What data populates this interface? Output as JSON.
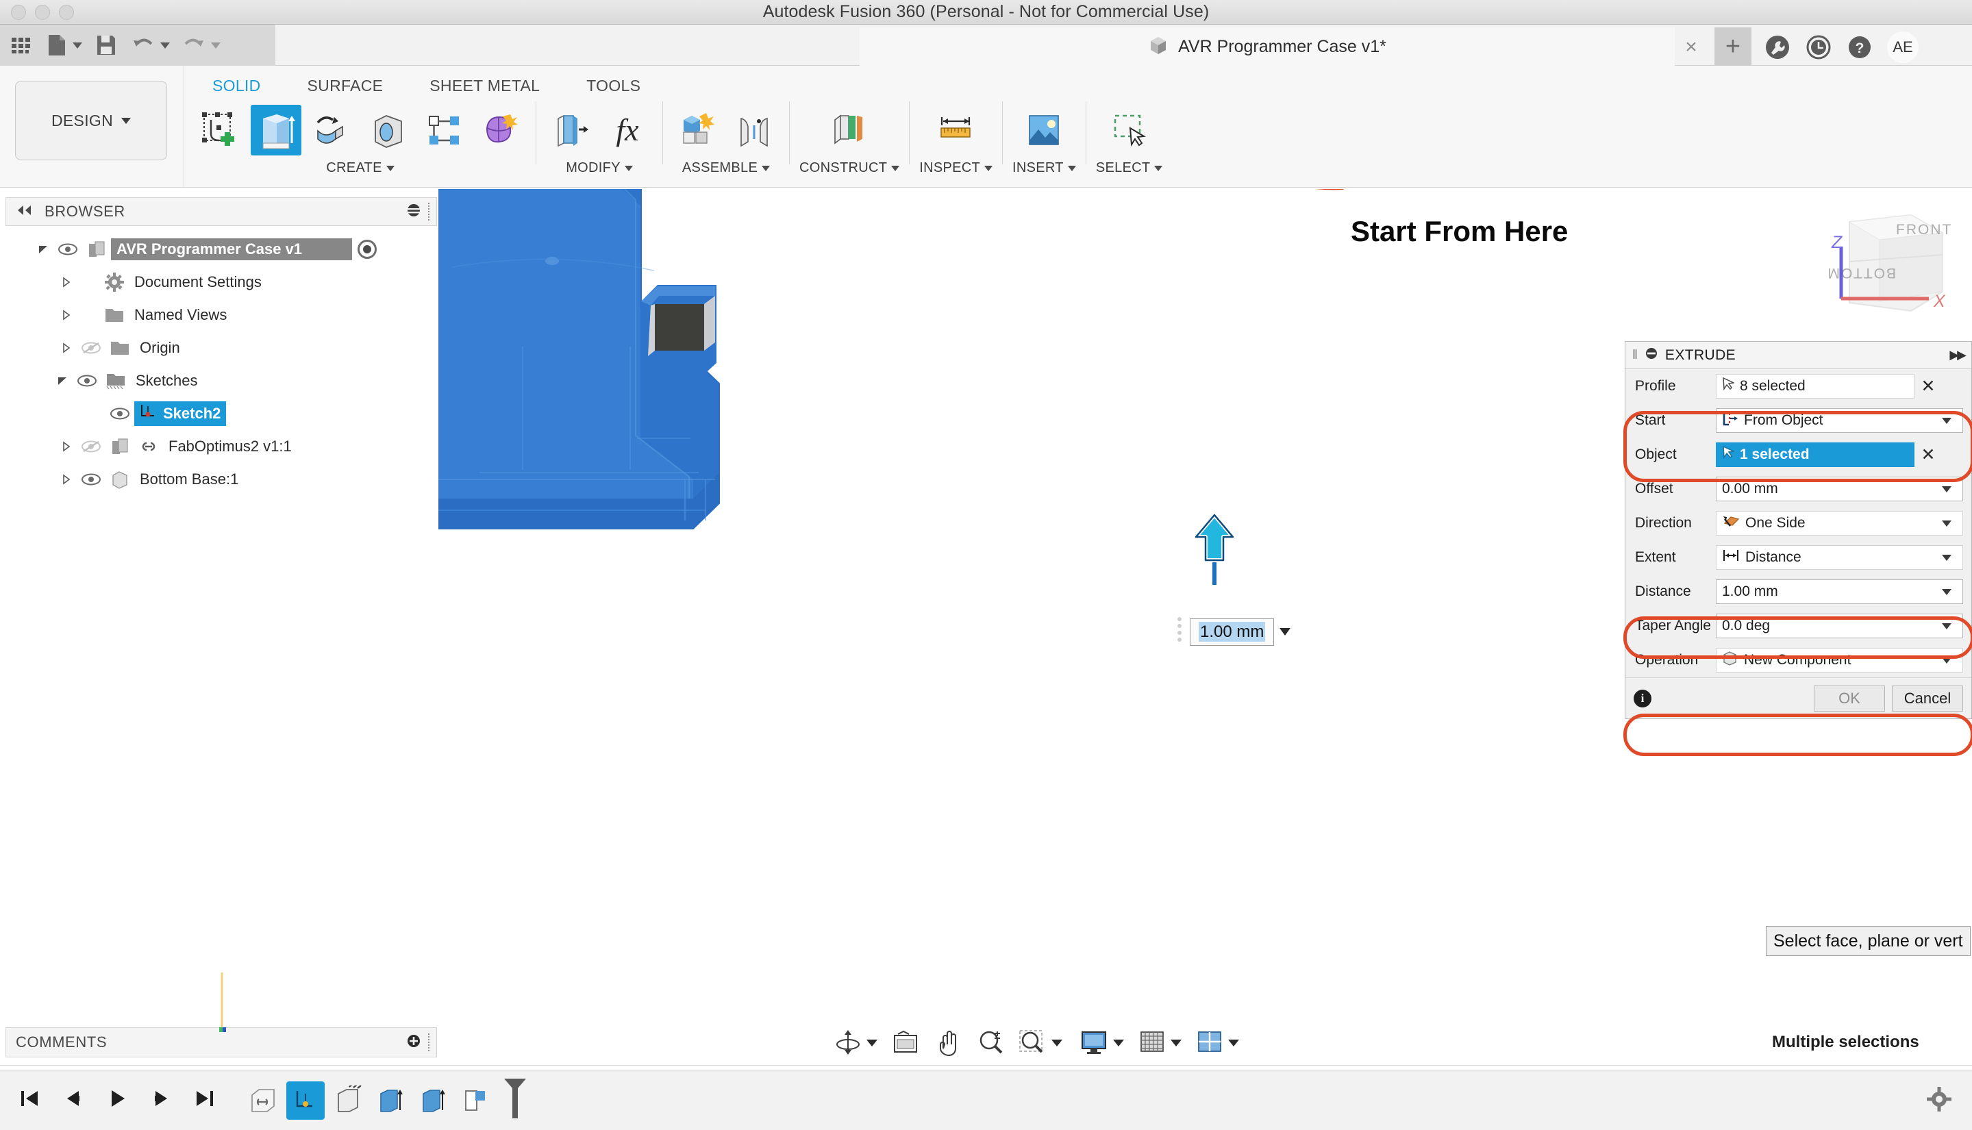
{
  "window": {
    "title": "Autodesk Fusion 360 (Personal - Not for Commercial Use)",
    "traffic_lights": [
      "close-button",
      "minimize-button",
      "zoom-button"
    ]
  },
  "quick_access": {
    "items": [
      {
        "name": "app-grid-icon",
        "label": "Show Data Panel"
      },
      {
        "name": "file-icon",
        "label": "File"
      },
      {
        "name": "save-icon",
        "label": "Save"
      },
      {
        "name": "undo-icon",
        "label": "Undo"
      },
      {
        "name": "redo-icon",
        "label": "Redo"
      }
    ]
  },
  "document_tab": {
    "label": "AVR Programmer Case v1*",
    "icon": "cube-icon",
    "close_label": "×",
    "new_tab_label": "+"
  },
  "header_icons": [
    {
      "name": "extensions-icon",
      "label": "Extensions"
    },
    {
      "name": "recent-icon",
      "label": "Recent"
    },
    {
      "name": "help-icon",
      "label": "Help"
    }
  ],
  "account": {
    "initials": "AE"
  },
  "workspace": {
    "label": "DESIGN"
  },
  "ribbon": {
    "tabs": [
      {
        "label": "SOLID",
        "active": true
      },
      {
        "label": "SURFACE",
        "active": false
      },
      {
        "label": "SHEET METAL",
        "active": false
      },
      {
        "label": "TOOLS",
        "active": false
      }
    ],
    "groups": [
      {
        "label": "CREATE",
        "tools": [
          {
            "name": "create-sketch-icon",
            "label": "Create Sketch"
          },
          {
            "name": "extrude-icon",
            "label": "Extrude",
            "selected": true
          },
          {
            "name": "revolve-icon",
            "label": "Revolve"
          },
          {
            "name": "hole-icon",
            "label": "Hole"
          },
          {
            "name": "rectangular-pattern-icon",
            "label": "Rectangular Pattern"
          },
          {
            "name": "form-icon",
            "label": "Create Form"
          }
        ]
      },
      {
        "label": "MODIFY",
        "tools": [
          {
            "name": "press-pull-icon",
            "label": "Press Pull"
          },
          {
            "name": "change-parameters-icon",
            "label": "Change Parameters"
          }
        ]
      },
      {
        "label": "ASSEMBLE",
        "tools": [
          {
            "name": "new-component-icon",
            "label": "New Component"
          },
          {
            "name": "joint-icon",
            "label": "Joint"
          }
        ]
      },
      {
        "label": "CONSTRUCT",
        "tools": [
          {
            "name": "offset-plane-icon",
            "label": "Offset Plane"
          }
        ]
      },
      {
        "label": "INSPECT",
        "tools": [
          {
            "name": "measure-icon",
            "label": "Measure"
          }
        ]
      },
      {
        "label": "INSERT",
        "tools": [
          {
            "name": "insert-image-icon",
            "label": "Insert McMaster-Carr Component"
          }
        ]
      },
      {
        "label": "SELECT",
        "tools": [
          {
            "name": "select-window-icon",
            "label": "Select"
          }
        ]
      }
    ]
  },
  "browser": {
    "title": "BROWSER",
    "collapse_icon": "collapse-left-icon",
    "options_icon": "browser-options-icon",
    "nodes": [
      {
        "label": "AVR Programmer Case v1",
        "icon": "component-icon",
        "expanded": true,
        "visible": true,
        "level": 0,
        "root": true,
        "selected": false,
        "radio": true
      },
      {
        "label": "Document Settings",
        "icon": "gear-icon",
        "expanded": false,
        "visible": null,
        "level": 1,
        "root": false,
        "selected": false
      },
      {
        "label": "Named Views",
        "icon": "folder-icon",
        "expanded": false,
        "visible": null,
        "level": 1,
        "root": false,
        "selected": false
      },
      {
        "label": "Origin",
        "icon": "folder-icon",
        "expanded": false,
        "visible": false,
        "level": 1,
        "root": false,
        "selected": false
      },
      {
        "label": "Sketches",
        "icon": "sketch-folder-icon",
        "expanded": true,
        "visible": true,
        "level": 1,
        "root": false,
        "selected": false
      },
      {
        "label": "Sketch2",
        "icon": "sketch-icon",
        "expanded": null,
        "visible": true,
        "level": 2,
        "root": false,
        "selected": true
      },
      {
        "label": "FabOptimus2 v1:1",
        "icon": "linked-component-icon",
        "expanded": false,
        "visible": false,
        "level": 1,
        "root": false,
        "selected": false
      },
      {
        "label": "Bottom Base:1",
        "icon": "body-icon",
        "expanded": false,
        "visible": true,
        "level": 1,
        "root": false,
        "selected": false
      }
    ]
  },
  "canvas": {
    "annotation": {
      "text": "Start From Here",
      "arrow": "curved-arrow",
      "highlight": "rounded-rect-highlight"
    },
    "dimension_field": {
      "value": "1.00 mm"
    },
    "manipulator": {
      "name": "extrude-arrow-handle"
    },
    "view_cube": {
      "faces": [
        "FRONT",
        "BOTTOM"
      ],
      "axes": [
        "Z",
        "X"
      ]
    },
    "model_colors": {
      "body": "#2a6fc9",
      "body_light": "#3e87dd",
      "cavity": "#3d3d3a",
      "edge": "#cfd3d8"
    }
  },
  "extrude_dialog": {
    "title": "EXTRUDE",
    "minimize_icon": "dialog-minimize-icon",
    "forward_icon": "dialog-expand-icon",
    "rows": [
      {
        "label": "Profile",
        "value": "8 selected",
        "kind": "selection",
        "icon": "cursor-icon",
        "clear": "✕",
        "highlighted": false,
        "active": false
      },
      {
        "label": "Start",
        "value": "From Object",
        "kind": "dropdown",
        "icon": "start-from-object-icon",
        "clear": null,
        "highlighted": true,
        "active": false
      },
      {
        "label": "Object",
        "value": "1 selected",
        "kind": "selection",
        "icon": "cursor-icon",
        "clear": "✕",
        "highlighted": true,
        "active": true
      },
      {
        "label": "Offset",
        "value": "0.00 mm",
        "kind": "dropdown",
        "icon": null,
        "clear": null,
        "highlighted": false,
        "active": false
      },
      {
        "label": "Direction",
        "value": "One Side",
        "kind": "dropdown",
        "icon": "one-side-icon",
        "clear": null,
        "highlighted": false,
        "active": false
      },
      {
        "label": "Extent",
        "value": "Distance",
        "kind": "dropdown",
        "icon": "distance-icon",
        "clear": null,
        "highlighted": false,
        "active": false
      },
      {
        "label": "Distance",
        "value": "1.00 mm",
        "kind": "dropdown",
        "icon": null,
        "clear": null,
        "highlighted": true,
        "active": false
      },
      {
        "label": "Taper Angle",
        "value": "0.0 deg",
        "kind": "dropdown",
        "icon": null,
        "clear": null,
        "highlighted": false,
        "active": false
      },
      {
        "label": "Operation",
        "value": "New Component",
        "kind": "dropdown",
        "icon": "new-component-cube-icon",
        "clear": null,
        "highlighted": true,
        "active": false
      }
    ],
    "info_icon": "info-icon",
    "ok_label": "OK",
    "cancel_label": "Cancel"
  },
  "status": {
    "tooltip": "Select face, plane or vert",
    "selection_text": "Multiple selections"
  },
  "comments": {
    "title": "COMMENTS",
    "add_icon": "add-comment-icon"
  },
  "view_toolbar": [
    {
      "name": "orbit-icon",
      "label": "Orbit",
      "caret": true
    },
    {
      "name": "look-at-icon",
      "label": "Look At",
      "caret": false
    },
    {
      "name": "pan-icon",
      "label": "Pan",
      "caret": false
    },
    {
      "name": "zoom-icon",
      "label": "Zoom",
      "caret": false
    },
    {
      "name": "fit-icon",
      "label": "Fit",
      "caret": true
    },
    {
      "name": "display-settings-icon",
      "label": "Display Settings",
      "caret": true
    },
    {
      "name": "grid-snaps-icon",
      "label": "Grid and Snaps",
      "caret": true
    },
    {
      "name": "viewports-icon",
      "label": "Viewports",
      "caret": true
    }
  ],
  "timeline": {
    "nav": [
      {
        "name": "go-to-beginning-icon",
        "label": "Go to Beginning"
      },
      {
        "name": "step-back-icon",
        "label": "Step Back"
      },
      {
        "name": "play-icon",
        "label": "Play Playback"
      },
      {
        "name": "step-forward-icon",
        "label": "Step Forward"
      },
      {
        "name": "go-to-end-icon",
        "label": "Go to End"
      }
    ],
    "features": [
      {
        "name": "timeline-feature-link",
        "selected": false
      },
      {
        "name": "timeline-feature-sketch",
        "selected": true
      },
      {
        "name": "timeline-feature-body",
        "selected": false
      },
      {
        "name": "timeline-feature-extrude-1",
        "selected": false
      },
      {
        "name": "timeline-feature-extrude-2",
        "selected": false
      },
      {
        "name": "timeline-feature-component",
        "selected": false
      }
    ],
    "settings_icon": "timeline-settings-icon"
  }
}
